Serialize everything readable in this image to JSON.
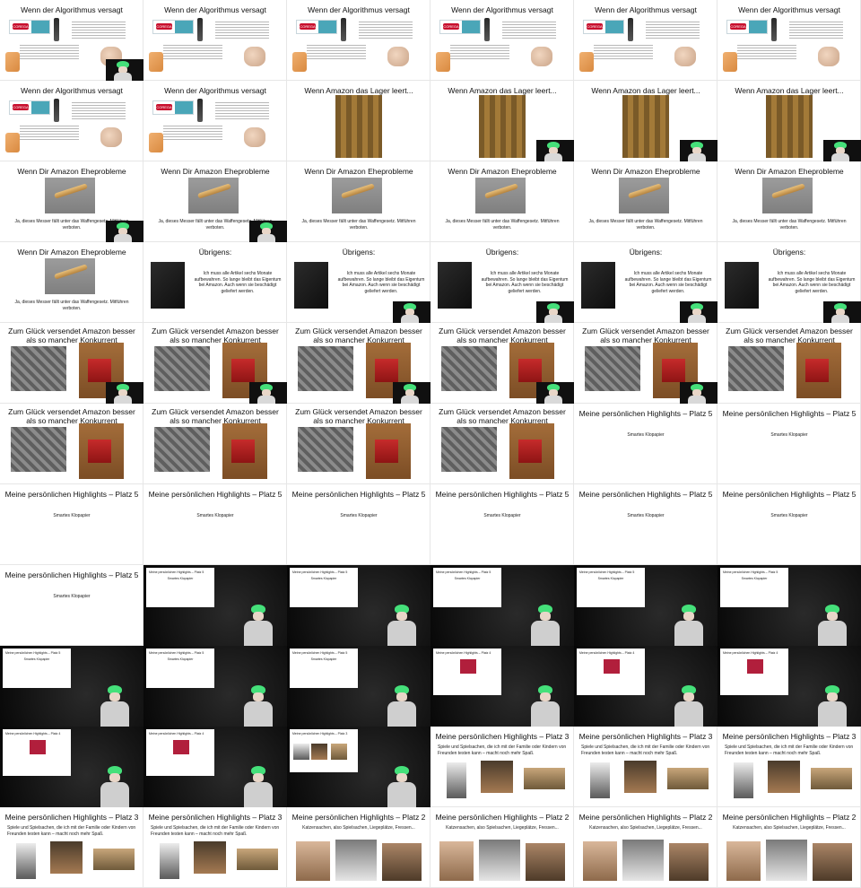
{
  "grid": {
    "cells": [
      {
        "kind": "algo",
        "title": "Wenn der Algorithmus versagt",
        "cam": true
      },
      {
        "kind": "algo",
        "title": "Wenn der Algorithmus versagt",
        "cam": false
      },
      {
        "kind": "algo",
        "title": "Wenn der Algorithmus versagt",
        "cam": false
      },
      {
        "kind": "algo",
        "title": "Wenn der Algorithmus versagt",
        "cam": false
      },
      {
        "kind": "algo",
        "title": "Wenn der Algorithmus versagt",
        "cam": false
      },
      {
        "kind": "algo",
        "title": "Wenn der Algorithmus versagt",
        "cam": false
      },
      {
        "kind": "algo",
        "title": "Wenn der Algorithmus versagt",
        "cam": false
      },
      {
        "kind": "algo",
        "title": "Wenn der Algorithmus versagt",
        "cam": false
      },
      {
        "kind": "lager",
        "title": "Wenn Amazon das Lager leert...",
        "cam": false
      },
      {
        "kind": "lager",
        "title": "Wenn Amazon das Lager leert...",
        "cam": true
      },
      {
        "kind": "lager",
        "title": "Wenn Amazon das Lager leert...",
        "cam": true
      },
      {
        "kind": "lager",
        "title": "Wenn Amazon das Lager leert...",
        "cam": true
      },
      {
        "kind": "knife",
        "title": "Wenn Dir Amazon Eheprobleme unterstellt.",
        "cam": true
      },
      {
        "kind": "knife",
        "title": "Wenn Dir Amazon Eheprobleme unterstellt.",
        "cam": true
      },
      {
        "kind": "knife",
        "title": "Wenn Dir Amazon Eheprobleme unterstellt.",
        "cam": false
      },
      {
        "kind": "knife",
        "title": "Wenn Dir Amazon Eheprobleme unterstellt.",
        "cam": false
      },
      {
        "kind": "knife",
        "title": "Wenn Dir Amazon Eheprobleme unterstellt.",
        "cam": false
      },
      {
        "kind": "knife",
        "title": "Wenn Dir Amazon Eheprobleme unterstellt.",
        "cam": false
      },
      {
        "kind": "knife",
        "title": "Wenn Dir Amazon Eheprobleme unterstellt.",
        "cam": false
      },
      {
        "kind": "uebrigens",
        "title": "Übrigens:",
        "cam": false
      },
      {
        "kind": "uebrigens",
        "title": "Übrigens:",
        "cam": true
      },
      {
        "kind": "uebrigens",
        "title": "Übrigens:",
        "cam": true
      },
      {
        "kind": "uebrigens",
        "title": "Übrigens:",
        "cam": true
      },
      {
        "kind": "uebrigens",
        "title": "Übrigens:",
        "cam": true
      },
      {
        "kind": "glueck",
        "title": "Zum Glück versendet Amazon besser als so mancher Konkurrent",
        "cam": true
      },
      {
        "kind": "glueck",
        "title": "Zum Glück versendet Amazon besser als so mancher Konkurrent",
        "cam": true
      },
      {
        "kind": "glueck",
        "title": "Zum Glück versendet Amazon besser als so mancher Konkurrent",
        "cam": true
      },
      {
        "kind": "glueck",
        "title": "Zum Glück versendet Amazon besser als so mancher Konkurrent",
        "cam": true
      },
      {
        "kind": "glueck",
        "title": "Zum Glück versendet Amazon besser als so mancher Konkurrent",
        "cam": true
      },
      {
        "kind": "glueck",
        "title": "Zum Glück versendet Amazon besser als so mancher Konkurrent",
        "cam": false
      },
      {
        "kind": "glueck",
        "title": "Zum Glück versendet Amazon besser als so mancher Konkurrent",
        "cam": false
      },
      {
        "kind": "glueck",
        "title": "Zum Glück versendet Amazon besser als so mancher Konkurrent",
        "cam": false
      },
      {
        "kind": "glueck",
        "title": "Zum Glück versendet Amazon besser als so mancher Konkurrent",
        "cam": false
      },
      {
        "kind": "glueck",
        "title": "Zum Glück versendet Amazon besser als so mancher Konkurrent",
        "cam": false
      },
      {
        "kind": "platz5",
        "title": "Meine persönlichen Highlights – Platz 5",
        "subtitle": "Smartes Klopapier"
      },
      {
        "kind": "platz5",
        "title": "Meine persönlichen Highlights – Platz 5",
        "subtitle": "Smartes Klopapier"
      },
      {
        "kind": "platz5",
        "title": "Meine persönlichen Highlights – Platz 5",
        "subtitle": "Smartes Klopapier"
      },
      {
        "kind": "platz5",
        "title": "Meine persönlichen Highlights – Platz 5",
        "subtitle": "Smartes Klopapier"
      },
      {
        "kind": "platz5",
        "title": "Meine persönlichen Highlights – Platz 5",
        "subtitle": "Smartes Klopapier"
      },
      {
        "kind": "platz5",
        "title": "Meine persönlichen Highlights – Platz 5",
        "subtitle": "Smartes Klopapier"
      },
      {
        "kind": "platz5",
        "title": "Meine persönlichen Highlights – Platz 5",
        "subtitle": "Smartes Klopapier"
      },
      {
        "kind": "platz5",
        "title": "Meine persönlichen Highlights – Platz 5",
        "subtitle": "Smartes Klopapier"
      },
      {
        "kind": "platz5",
        "title": "Meine persönlichen Highlights – Platz 5",
        "subtitle": "Smartes Klopapier"
      },
      {
        "kind": "stage",
        "title": "Meine persönlichen Highlights – Platz 5",
        "subtitle": "Smartes Klopapier"
      },
      {
        "kind": "stage",
        "title": "Meine persönlichen Highlights – Platz 5",
        "subtitle": "Smartes Klopapier"
      },
      {
        "kind": "stage",
        "title": "Meine persönlichen Highlights – Platz 5",
        "subtitle": "Smartes Klopapier"
      },
      {
        "kind": "stage",
        "title": "Meine persönlichen Highlights – Platz 5",
        "subtitle": "Smartes Klopapier"
      },
      {
        "kind": "stage",
        "title": "Meine persönlichen Highlights – Platz 5",
        "subtitle": "Smartes Klopapier"
      },
      {
        "kind": "stage",
        "title": "Meine persönlichen Highlights – Platz 5",
        "subtitle": "Smartes Klopapier"
      },
      {
        "kind": "stage",
        "title": "Meine persönlichen Highlights – Platz 5",
        "subtitle": "Smartes Klopapier"
      },
      {
        "kind": "stage",
        "title": "Meine persönlichen Highlights – Platz 5",
        "subtitle": "Smartes Klopapier"
      },
      {
        "kind": "stage-card",
        "title": "Meine persönlichen Highlights – Platz 4",
        "subtitle": ""
      },
      {
        "kind": "stage-card",
        "title": "Meine persönlichen Highlights – Platz 4",
        "subtitle": ""
      },
      {
        "kind": "stage-card",
        "title": "Meine persönlichen Highlights – Platz 4",
        "subtitle": ""
      },
      {
        "kind": "stage-card",
        "title": "Meine persönlichen Highlights – Platz 4",
        "subtitle": ""
      },
      {
        "kind": "stage-card",
        "title": "Meine persönlichen Highlights – Platz 4",
        "subtitle": ""
      },
      {
        "kind": "stage-3",
        "title": "Meine persönlichen Highlights – Platz 3",
        "subtitle": ""
      },
      {
        "kind": "platz3",
        "title": "Meine persönlichen Highlights – Platz 3",
        "subtitle": "Spiele und Spielsachen, die ich mit der Familie oder Kindern von Freunden testen kann – macht noch mehr Spaß."
      },
      {
        "kind": "platz3",
        "title": "Meine persönlichen Highlights – Platz 3",
        "subtitle": "Spiele und Spielsachen, die ich mit der Familie oder Kindern von Freunden testen kann – macht noch mehr Spaß."
      },
      {
        "kind": "platz3",
        "title": "Meine persönlichen Highlights – Platz 3",
        "subtitle": "Spiele und Spielsachen, die ich mit der Familie oder Kindern von Freunden testen kann – macht noch mehr Spaß."
      },
      {
        "kind": "platz3",
        "title": "Meine persönlichen Highlights – Platz 3",
        "subtitle": "Spiele und Spielsachen, die ich mit der Familie oder Kindern von Freunden testen kann – macht noch mehr Spaß."
      },
      {
        "kind": "platz3",
        "title": "Meine persönlichen Highlights – Platz 3",
        "subtitle": "Spiele und Spielsachen, die ich mit der Familie oder Kindern von Freunden testen kann – macht noch mehr Spaß."
      },
      {
        "kind": "platz2",
        "title": "Meine persönlichen Highlights – Platz 2",
        "subtitle": "Katzensachen, also Spielsachen, Liegeplätze, Fressen..."
      },
      {
        "kind": "platz2",
        "title": "Meine persönlichen Highlights – Platz 2",
        "subtitle": "Katzensachen, also Spielsachen, Liegeplätze, Fressen..."
      },
      {
        "kind": "platz2",
        "title": "Meine persönlichen Highlights – Platz 2",
        "subtitle": "Katzensachen, also Spielsachen, Liegeplätze, Fressen..."
      },
      {
        "kind": "platz2",
        "title": "Meine persönlichen Highlights – Platz 2",
        "subtitle": "Katzensachen, also Spielsachen, Liegeplätze, Fressen..."
      }
    ]
  },
  "captions": {
    "knife": "Ja, dieses Messer fällt unter das Waffengesetz. Mitführen verboten.",
    "uebrigens": "Ich muss alle Artikel sechs Monate aufbewahren. So lange bleibt das Eigentum bei Amazon. Auch wenn sie beschädigt geliefert werden.",
    "corega": "COREGA"
  }
}
